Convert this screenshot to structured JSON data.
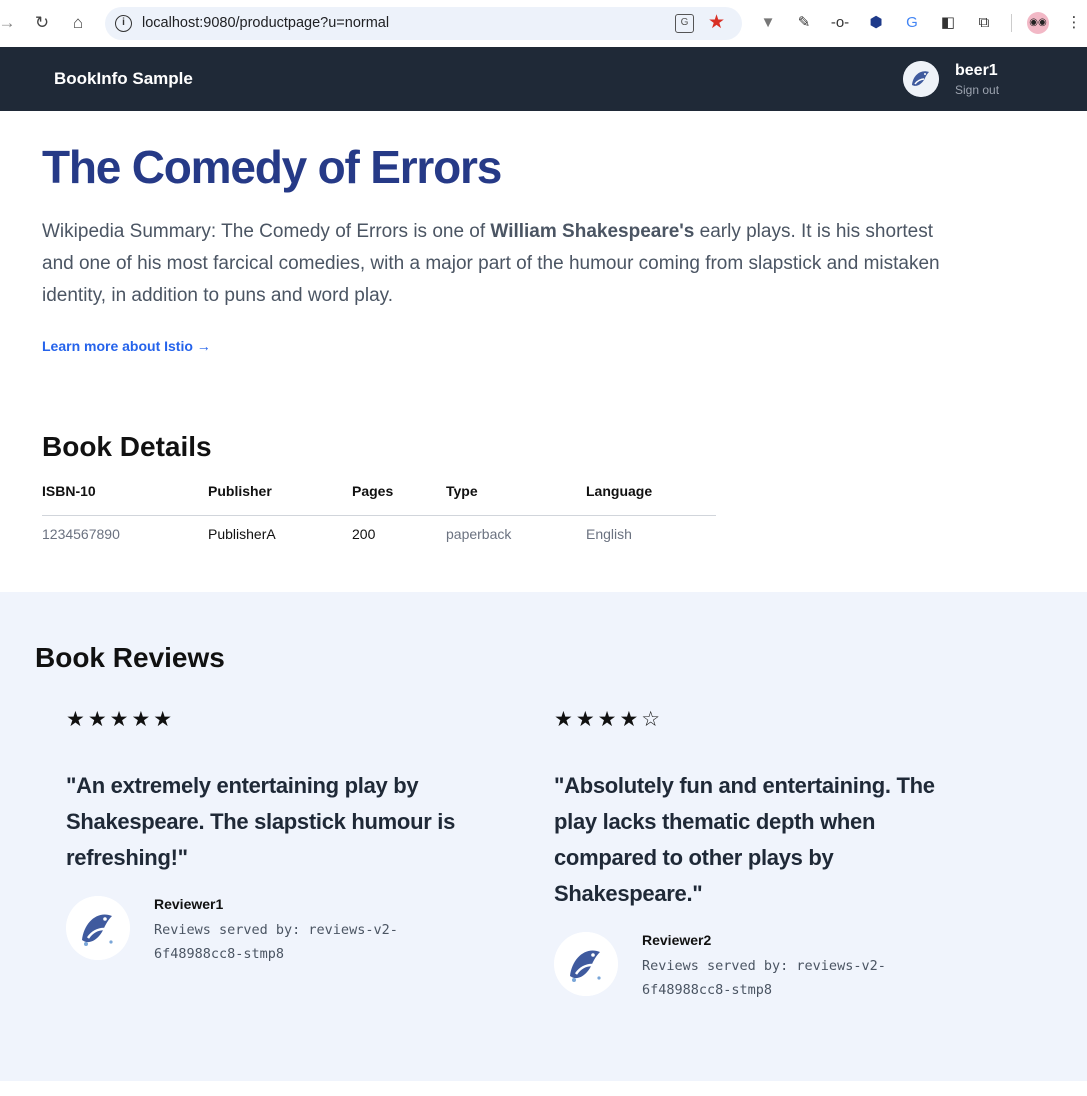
{
  "browser": {
    "url": "localhost:9080/productpage?u=normal",
    "icons": [
      "back-icon",
      "reload-icon",
      "home-icon",
      "info-icon",
      "translate-icon",
      "bookmark-star-icon",
      "extension-icons",
      "profile-avatar"
    ]
  },
  "header": {
    "brand": "BookInfo Sample",
    "user_name": "beer1",
    "sign_out": "Sign out"
  },
  "product": {
    "title": "The Comedy of Errors",
    "summary_prefix": "Wikipedia Summary: The Comedy of Errors is one of ",
    "summary_bold": "William Shakespeare's",
    "summary_suffix": " early plays. It is his shortest and one of his most farcical comedies, with a major part of the humour coming from slapstick and mistaken identity, in addition to puns and word play.",
    "learn_more": "Learn more about Istio →"
  },
  "details": {
    "heading": "Book Details",
    "columns": [
      "ISBN-10",
      "Publisher",
      "Pages",
      "Type",
      "Language"
    ],
    "row": [
      "1234567890",
      "PublisherA",
      "200",
      "paperback",
      "English"
    ]
  },
  "reviews": {
    "heading": "Book Reviews",
    "items": [
      {
        "rating": 5,
        "max": 5,
        "stars_text": "★★★★★",
        "quote": "\"An extremely entertaining play by Shakespeare. The slapstick humour is refreshing!\"",
        "reviewer": "Reviewer1",
        "served_by": "Reviews served by: reviews-v2-6f48988cc8-stmp8"
      },
      {
        "rating": 4,
        "max": 5,
        "stars_text": "★★★★☆",
        "quote": "\"Absolutely fun and entertaining. The play lacks thematic depth when compared to other plays by Shakespeare.\"",
        "reviewer": "Reviewer2",
        "served_by": "Reviews served by: reviews-v2-6f48988cc8-stmp8"
      }
    ]
  },
  "colors": {
    "header_bg": "#1f2937",
    "title": "#263a87",
    "link": "#2563eb",
    "reviews_bg": "#f0f4fc"
  }
}
